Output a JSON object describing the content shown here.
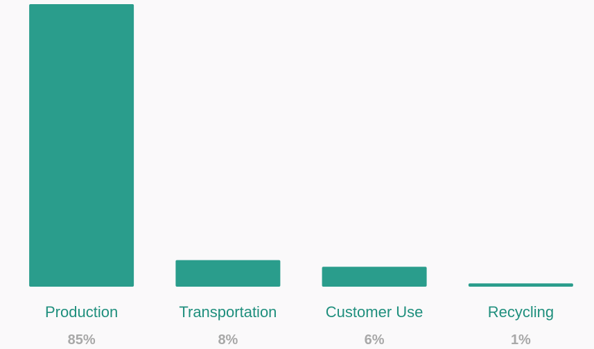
{
  "colors": {
    "bar": "#2a9d8c",
    "category_text": "#1f8f7d",
    "value_text": "#a8a8a8",
    "background": "#faf9fa"
  },
  "chart_data": {
    "type": "bar",
    "categories": [
      "Production",
      "Transportation",
      "Customer Use",
      "Recycling"
    ],
    "values": [
      85,
      8,
      6,
      1
    ],
    "value_labels": [
      "85%",
      "8%",
      "6%",
      "1%"
    ],
    "ylim": [
      0,
      85
    ],
    "grid": false,
    "legend": "none"
  }
}
